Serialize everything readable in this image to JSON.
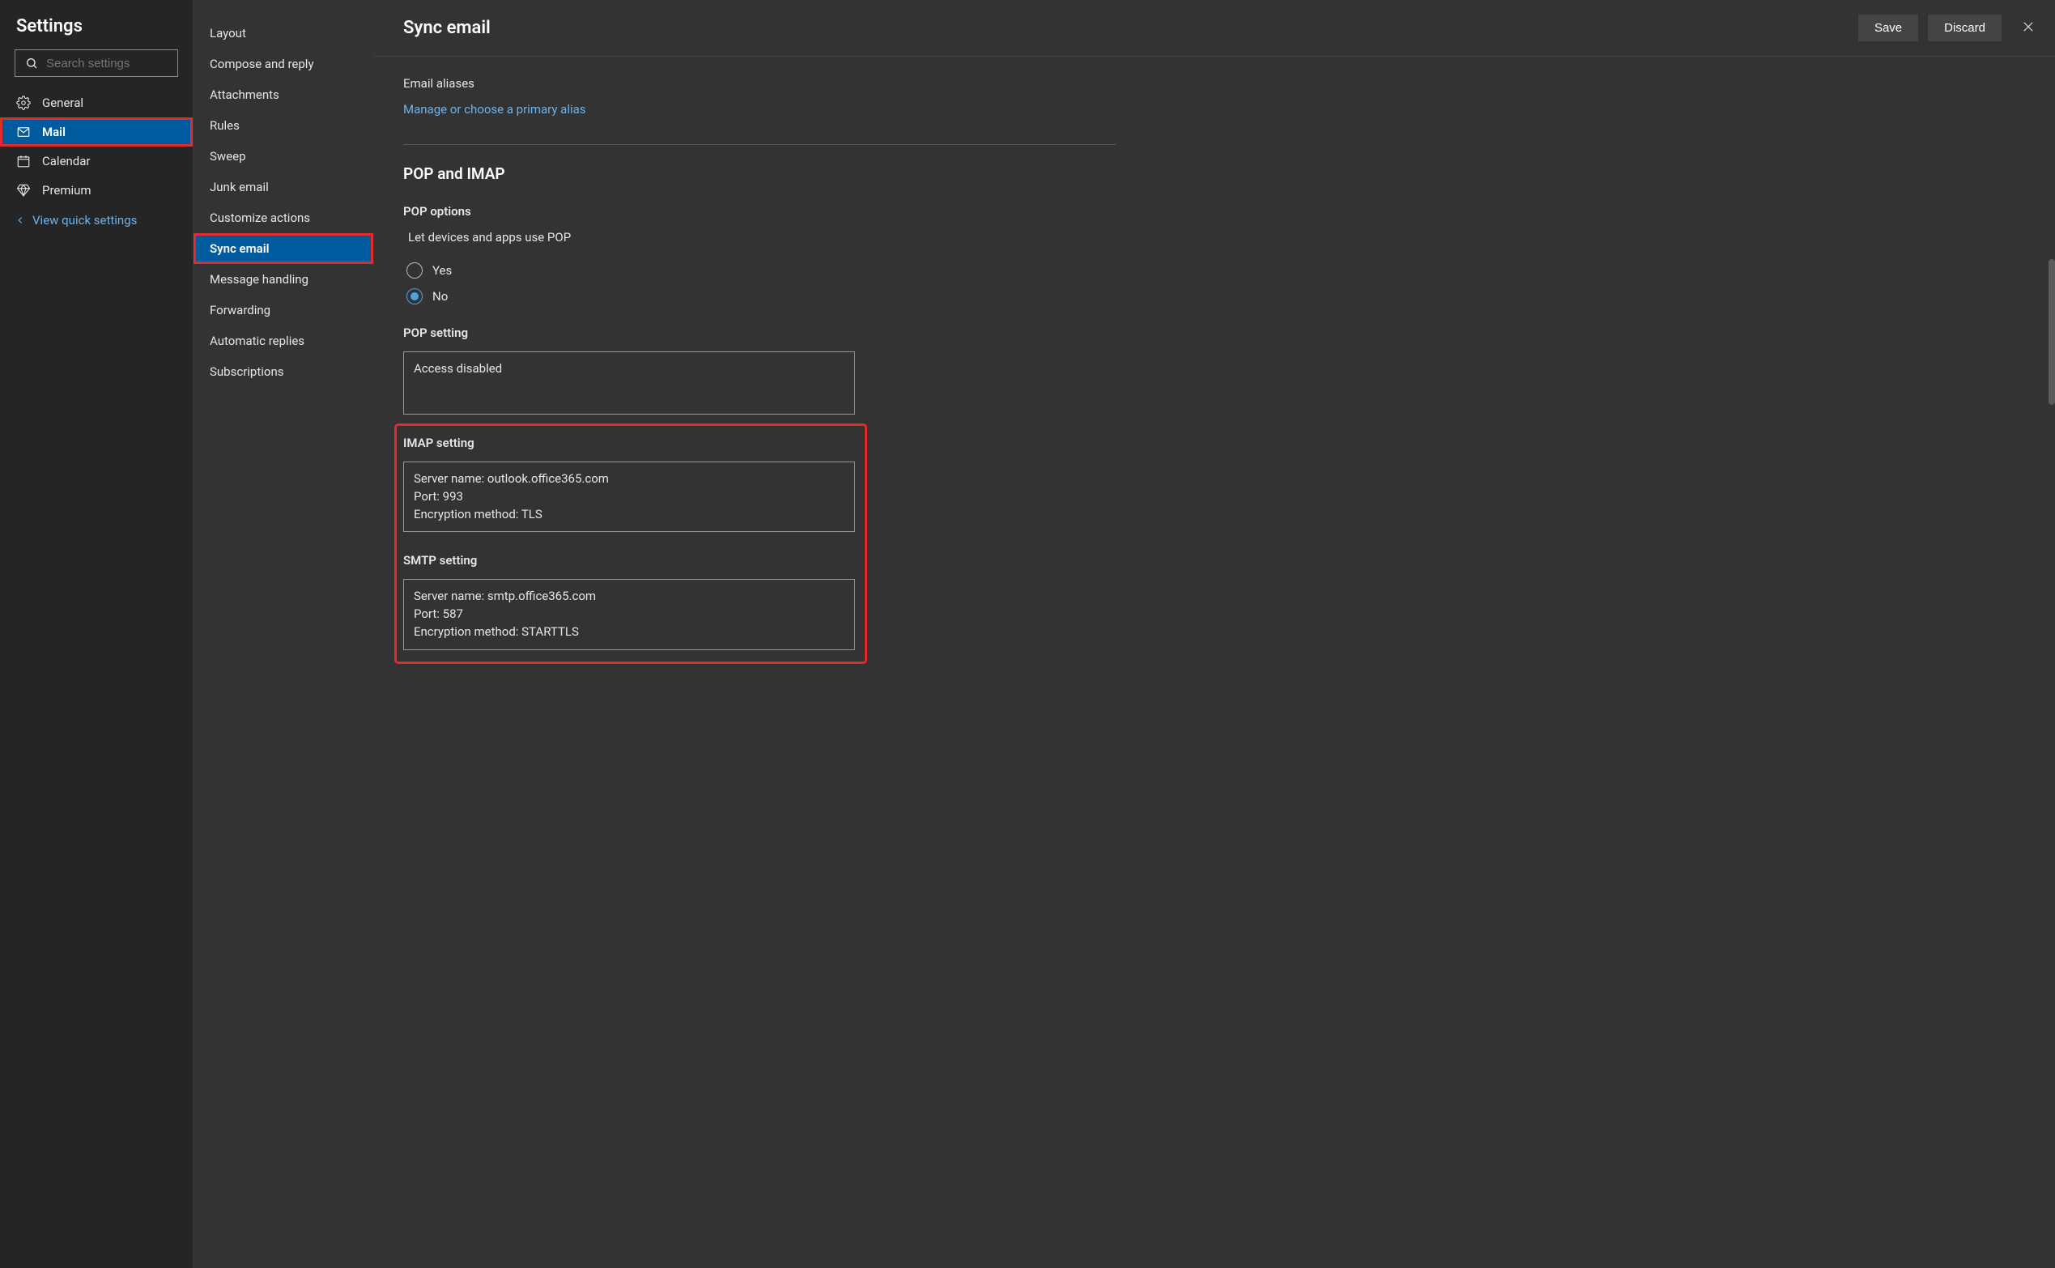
{
  "sidebar": {
    "title": "Settings",
    "search_placeholder": "Search settings",
    "items": [
      {
        "label": "General",
        "icon": "gear"
      },
      {
        "label": "Mail",
        "icon": "mail",
        "active": true
      },
      {
        "label": "Calendar",
        "icon": "calendar"
      },
      {
        "label": "Premium",
        "icon": "diamond"
      }
    ],
    "quick_link": "View quick settings"
  },
  "subnav": {
    "items": [
      "Layout",
      "Compose and reply",
      "Attachments",
      "Rules",
      "Sweep",
      "Junk email",
      "Customize actions",
      "Sync email",
      "Message handling",
      "Forwarding",
      "Automatic replies",
      "Subscriptions"
    ],
    "active_index": 7
  },
  "content": {
    "title": "Sync email",
    "save_label": "Save",
    "discard_label": "Discard",
    "aliases": {
      "heading": "Email aliases",
      "link": "Manage or choose a primary alias"
    },
    "pop_imap": {
      "heading": "POP and IMAP",
      "pop_options": {
        "heading": "POP options",
        "desc": "Let devices and apps use POP",
        "yes": "Yes",
        "no": "No",
        "selected": "No"
      },
      "pop_setting": {
        "heading": "POP setting",
        "text": "Access disabled"
      },
      "imap_setting": {
        "heading": "IMAP setting",
        "text": "Server name: outlook.office365.com\nPort: 993\nEncryption method: TLS"
      },
      "smtp_setting": {
        "heading": "SMTP setting",
        "text": "Server name: smtp.office365.com\nPort: 587\nEncryption method: STARTTLS"
      }
    }
  }
}
